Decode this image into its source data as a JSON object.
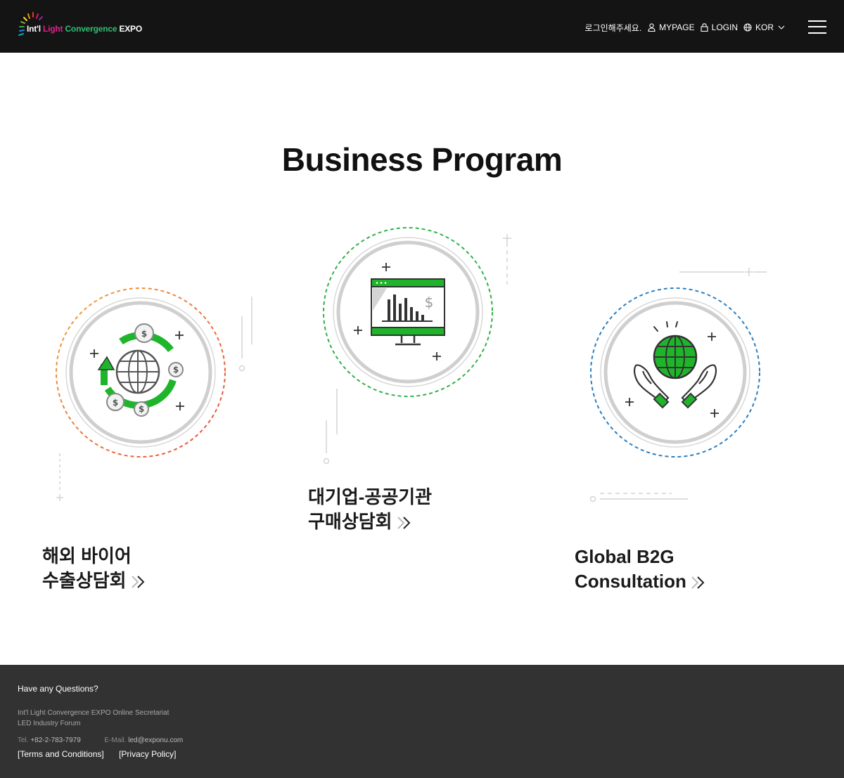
{
  "header": {
    "logo": {
      "part1": "Int'l",
      "part2": "Light",
      "part3": "Convergence",
      "part4": "EXPO"
    },
    "greeting": "로그인해주세요.",
    "mypage_label": "MYPAGE",
    "login_label": "LOGIN",
    "language_label": "KOR"
  },
  "main": {
    "title": "Business Program",
    "programs": [
      {
        "line1": "해외 바이어",
        "line2": "수출상담회",
        "icon": "global-exchange-icon",
        "ring_color": "orange-red gradient"
      },
      {
        "line1": "대기업-공공기관",
        "line2": "구매상담회",
        "icon": "monitor-chart-icon",
        "ring_color": "#2fb24a"
      },
      {
        "line1": "Global B2G",
        "line2": "Consultation",
        "icon": "hands-globe-icon",
        "ring_color": "#2a7fc1"
      }
    ]
  },
  "footer": {
    "question": "Have any Questions?",
    "org_line1": "Int'l Light Convergence EXPO Online Secretariat",
    "org_line2": "LED Industry Forum",
    "tel_label": "Tel.",
    "tel_value": "+82-2-783-7979",
    "email_label": "E-Mail.",
    "email_value": "led@exponu.com",
    "terms_label": "[Terms and Conditions]",
    "privacy_label": "[Privacy Policy]"
  },
  "colors": {
    "header_bg": "#141414",
    "footer_bg": "#323232",
    "accent_green": "#1fb52b",
    "ring_gray": "#cfcfcf"
  }
}
